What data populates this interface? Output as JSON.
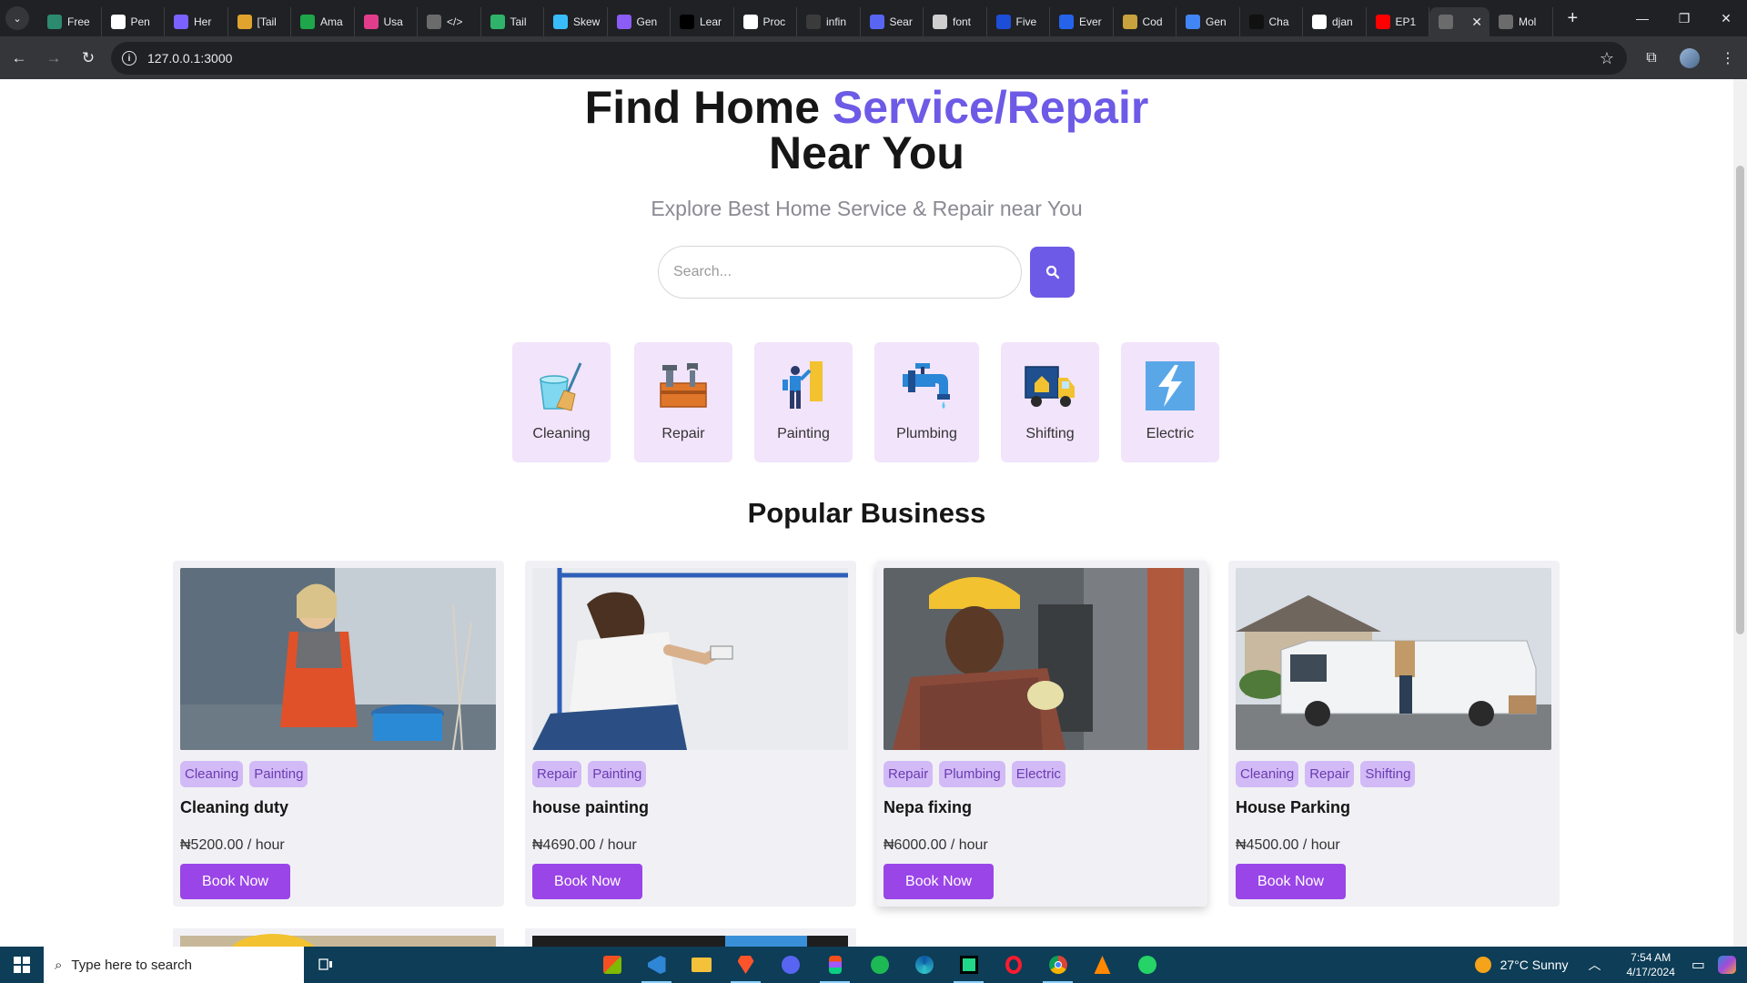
{
  "browser": {
    "tabs": [
      {
        "label": "Free",
        "color": "#2c8a6e"
      },
      {
        "label": "Pen",
        "color": "#ffffff"
      },
      {
        "label": "Her",
        "color": "#7b61ff"
      },
      {
        "label": "[Tail",
        "color": "#e0a32e"
      },
      {
        "label": "Ama",
        "color": "#1ea64a"
      },
      {
        "label": "Usa",
        "color": "#e23d8c"
      },
      {
        "label": "</>",
        "color": "#6b6b6b"
      },
      {
        "label": "Tail",
        "color": "#2fb36a"
      },
      {
        "label": "Skew",
        "color": "#38bdf8"
      },
      {
        "label": "Gen",
        "color": "#8b5cf6"
      },
      {
        "label": "Lear",
        "color": "#000000"
      },
      {
        "label": "Proc",
        "color": "#ffffff"
      },
      {
        "label": "infin",
        "color": "#3b3b3b"
      },
      {
        "label": "Sear",
        "color": "#5865f2"
      },
      {
        "label": "font",
        "color": "#cfcfcf"
      },
      {
        "label": "Five",
        "color": "#1d4ed8"
      },
      {
        "label": "Ever",
        "color": "#2563eb"
      },
      {
        "label": "Cod",
        "color": "#c8a23c"
      },
      {
        "label": "Gen",
        "color": "#4285f4"
      },
      {
        "label": "Cha",
        "color": "#111111"
      },
      {
        "label": "djan",
        "color": "#ffffff"
      },
      {
        "label": "EP1",
        "color": "#ff0000"
      },
      {
        "label": "",
        "color": "#6b6b6b"
      },
      {
        "label": "Mol",
        "color": "#6b6b6b"
      }
    ],
    "url": "127.0.0.1:3000"
  },
  "hero": {
    "title_part1": "Find Home ",
    "title_accent": "Service/Repair",
    "title_part2": "Near You",
    "subtitle": "Explore Best Home Service & Repair near You",
    "search_placeholder": "Search..."
  },
  "categories": [
    {
      "label": "Cleaning",
      "icon": "cleaning-icon"
    },
    {
      "label": "Repair",
      "icon": "toolbox-icon"
    },
    {
      "label": "Painting",
      "icon": "painter-icon"
    },
    {
      "label": "Plumbing",
      "icon": "faucet-icon"
    },
    {
      "label": "Shifting",
      "icon": "moving-truck-icon"
    },
    {
      "label": "Electric",
      "icon": "lightning-icon"
    }
  ],
  "section_title": "Popular Business",
  "businesses": [
    {
      "name": "Cleaning duty",
      "tags": [
        "Cleaning",
        "Painting"
      ],
      "price": "₦5200.00 / hour",
      "button": "Book Now"
    },
    {
      "name": "house painting",
      "tags": [
        "Repair",
        "Painting"
      ],
      "price": "₦4690.00 / hour",
      "button": "Book Now"
    },
    {
      "name": "Nepa fixing",
      "tags": [
        "Repair",
        "Plumbing",
        "Electric"
      ],
      "price": "₦6000.00 / hour",
      "button": "Book Now"
    },
    {
      "name": "House Parking",
      "tags": [
        "Cleaning",
        "Repair",
        "Shifting"
      ],
      "price": "₦4500.00 / hour",
      "button": "Book Now"
    }
  ],
  "taskbar": {
    "search_placeholder": "Type here to search",
    "weather": "27°C  Sunny",
    "time": "7:54 AM",
    "date": "4/17/2024"
  },
  "colors": {
    "accent": "#6d5ae6",
    "button": "#9a45e8",
    "tag_bg": "#d2baf7",
    "category_bg": "#f2e4fb"
  }
}
